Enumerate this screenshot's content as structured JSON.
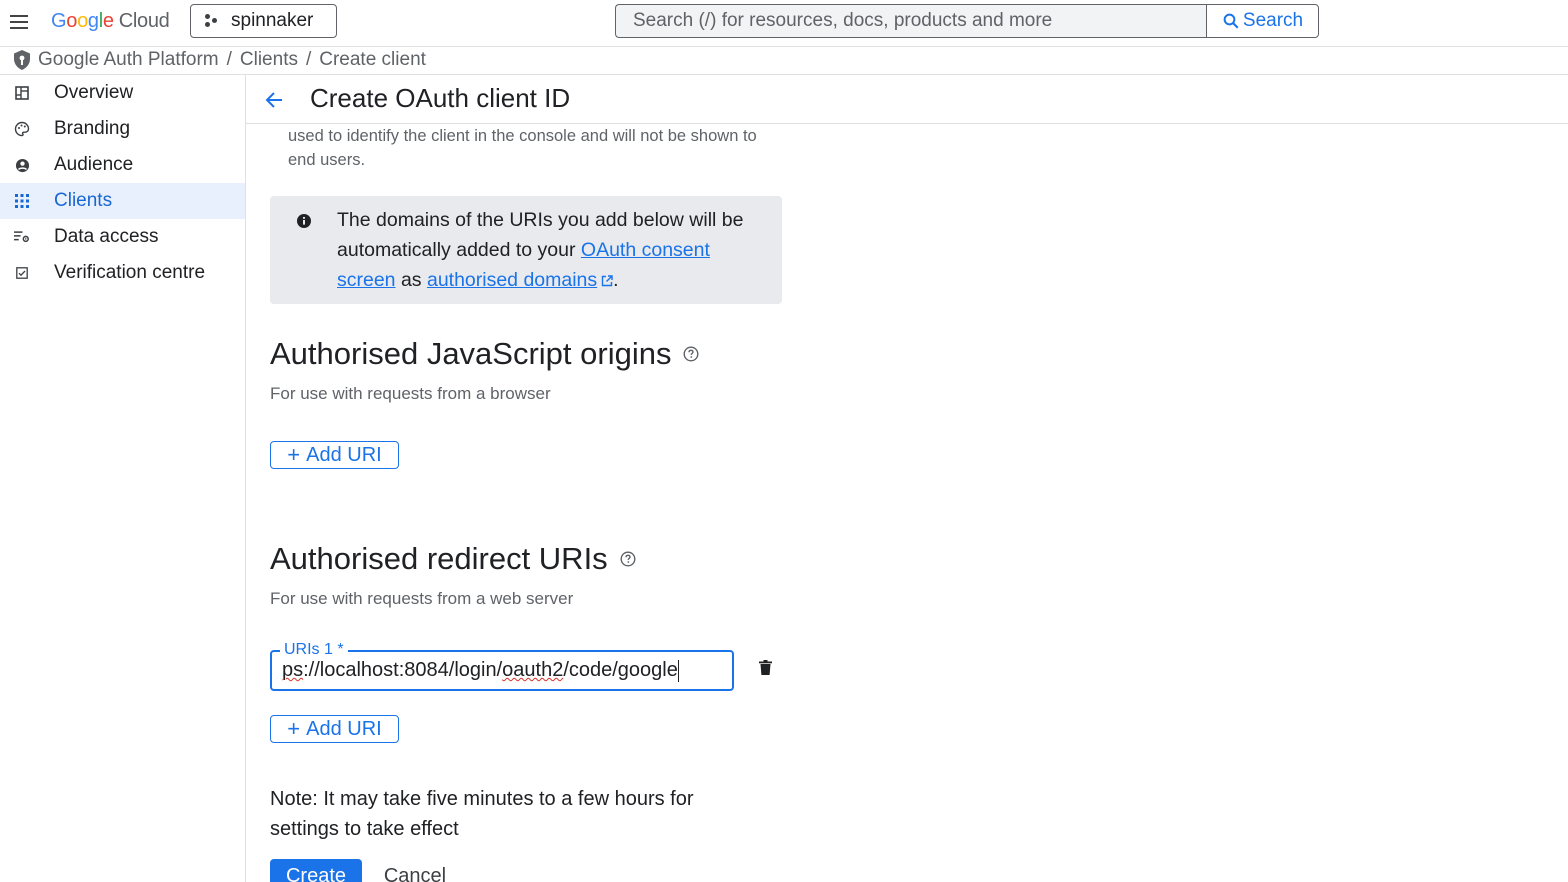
{
  "topbar": {
    "logo_letters": [
      "G",
      "o",
      "o",
      "g",
      "l",
      "e"
    ],
    "logo_suffix": "Cloud",
    "project_name": "spinnaker",
    "search_placeholder": "Search (/) for resources, docs, products and more",
    "search_button": "Search"
  },
  "breadcrumb": {
    "items": [
      "Google Auth Platform",
      "Clients",
      "Create client"
    ],
    "separator": "/"
  },
  "sidebar": {
    "items": [
      {
        "label": "Overview",
        "icon": "dashboard-icon"
      },
      {
        "label": "Branding",
        "icon": "palette-icon"
      },
      {
        "label": "Audience",
        "icon": "person-icon"
      },
      {
        "label": "Clients",
        "icon": "apps-grid-icon",
        "active": true
      },
      {
        "label": "Data access",
        "icon": "data-settings-icon"
      },
      {
        "label": "Verification centre",
        "icon": "check-box-icon"
      }
    ]
  },
  "page": {
    "title": "Create OAuth client ID",
    "helper_top": "used to identify the client in the console and will not be shown to end users."
  },
  "info_box": {
    "text_before": "The domains of the URIs you add below will be automatically added to your ",
    "link1": "OAuth consent screen",
    "text_middle": " as ",
    "link2": "authorised domains",
    "text_after": "."
  },
  "js_origins": {
    "title": "Authorised JavaScript origins",
    "subtitle": "For use with requests from a browser",
    "add_label": "Add URI"
  },
  "redirect_uris": {
    "title": "Authorised redirect URIs",
    "subtitle": "For use with requests from a web server",
    "field_label": "URIs 1 *",
    "value_prefix": "ps",
    "value_middle": "://localhost:8084/login/",
    "value_spell": "oauth2",
    "value_suffix": "/code/google",
    "add_label": "Add URI"
  },
  "note": "Note: It may take five minutes to a few hours for settings to take effect",
  "actions": {
    "create": "Create",
    "cancel": "Cancel"
  },
  "colors": {
    "accent": "#1a73e8",
    "active_bg": "#e8f0fe",
    "info_bg": "#e8eaed"
  }
}
